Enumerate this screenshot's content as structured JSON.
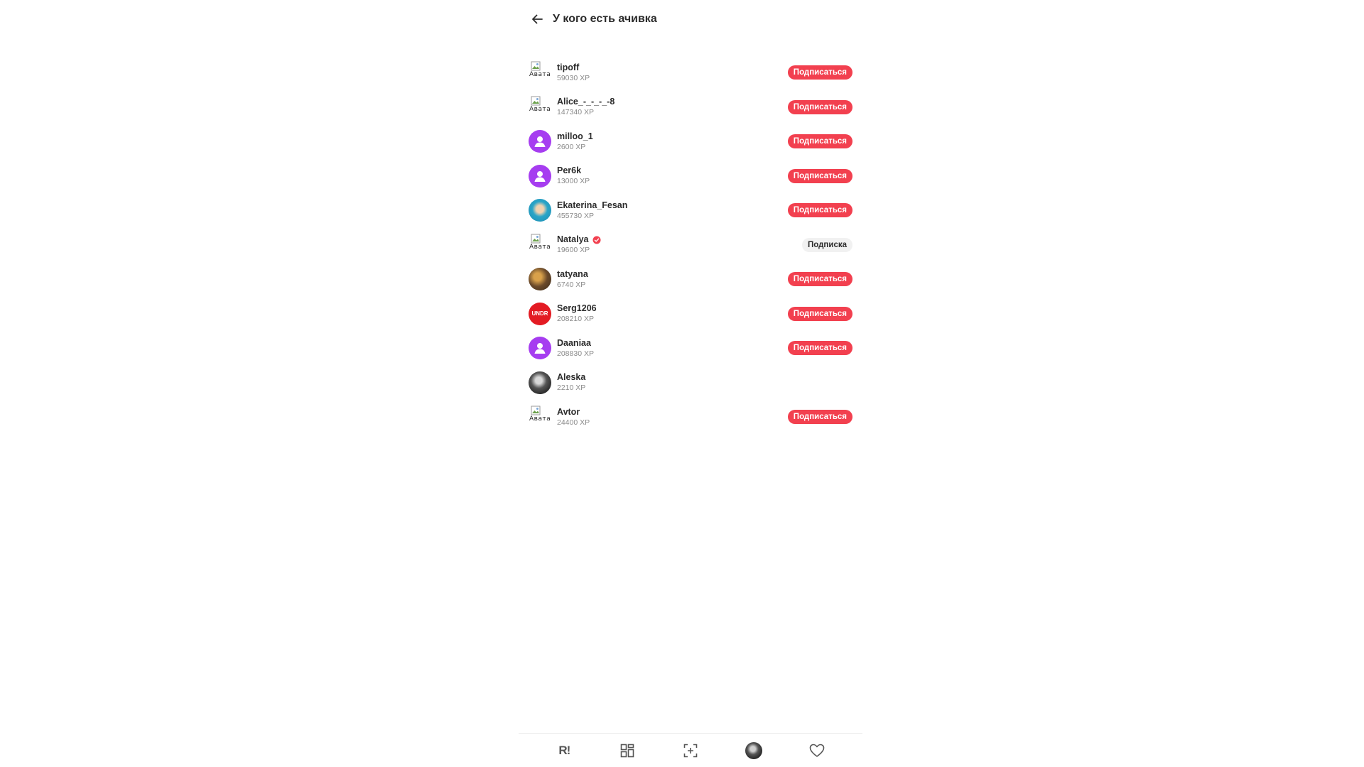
{
  "header": {
    "title": "У кого есть ачивка"
  },
  "users": [
    {
      "name": "tipoff",
      "xp": "59030 XP",
      "avatar": "broken",
      "avatar_alt": "Авата",
      "button": "Подписаться",
      "state": "subscribe"
    },
    {
      "name": "Alice_-_-_-_-8",
      "xp": "147340 XP",
      "avatar": "broken",
      "avatar_alt": "Авата",
      "button": "Подписаться",
      "state": "subscribe"
    },
    {
      "name": "milloo_1",
      "xp": "2600 XP",
      "avatar": "purple",
      "button": "Подписаться",
      "state": "subscribe"
    },
    {
      "name": "Per6k",
      "xp": "13000 XP",
      "avatar": "purple",
      "button": "Подписаться",
      "state": "subscribe"
    },
    {
      "name": "Ekaterina_Fesan",
      "xp": "455730 XP",
      "avatar": "photo-blue",
      "button": "Подписаться",
      "state": "subscribe"
    },
    {
      "name": "Natalya",
      "xp": "19600 XP",
      "avatar": "broken",
      "avatar_alt": "Авата",
      "verified": true,
      "button": "Подписка",
      "state": "following"
    },
    {
      "name": "tatyana",
      "xp": "6740 XP",
      "avatar": "photo-brown",
      "button": "Подписаться",
      "state": "subscribe"
    },
    {
      "name": "Serg1206",
      "xp": "208210 XP",
      "avatar": "red-logo",
      "avatar_text": "UNDR",
      "button": "Подписаться",
      "state": "subscribe"
    },
    {
      "name": "Daaniaa",
      "xp": "208830 XP",
      "avatar": "purple",
      "button": "Подписаться",
      "state": "subscribe"
    },
    {
      "name": "Aleska",
      "xp": "2210 XP",
      "avatar": "photo-gray",
      "button": "",
      "state": "self"
    },
    {
      "name": "Avtor",
      "xp": "24400 XP",
      "avatar": "broken",
      "avatar_alt": "Авата",
      "button": "Подписаться",
      "state": "subscribe"
    }
  ],
  "nav": {
    "logo": "R!",
    "items": [
      "home-logo",
      "grid-icon",
      "add-capture-icon",
      "profile-avatar",
      "heart-icon"
    ]
  },
  "colors": {
    "accent": "#f2404f",
    "avatar_default": "#a63df0",
    "text": "#2b2b2b",
    "muted": "#8a8a8a"
  }
}
